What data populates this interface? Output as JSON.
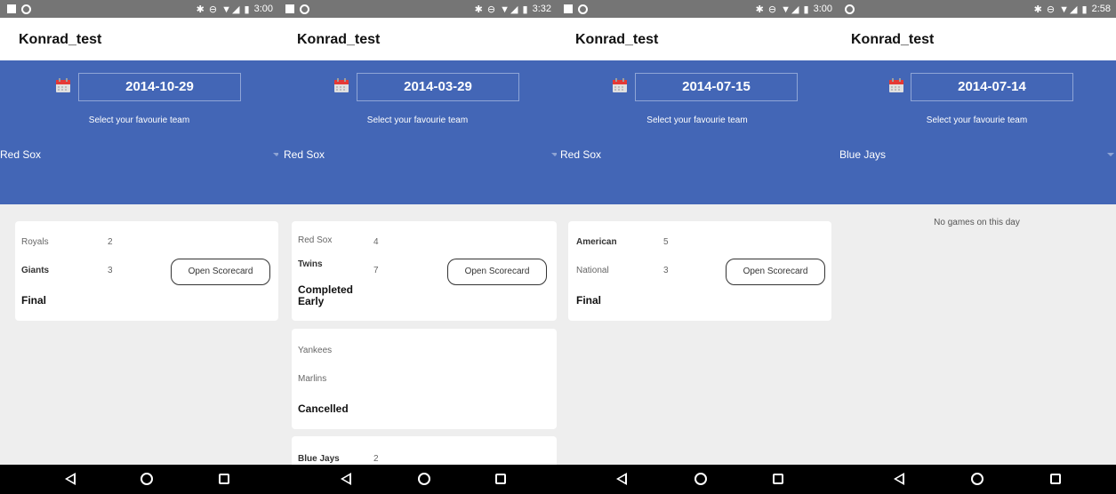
{
  "colors": {
    "status_bar": "#757575",
    "header_blue": "#4366b6",
    "background": "#eeeeee",
    "nav_bar": "#000000"
  },
  "screens": [
    {
      "status_time": "3:00",
      "title": "Konrad_test",
      "date": "2014-10-29",
      "select_label": "Select your favourie team",
      "team": "Red Sox",
      "games": [
        {
          "team1": "Royals",
          "score1": "2",
          "team2": "Giants",
          "score2": "3",
          "status": "Final",
          "button": "Open Scorecard"
        }
      ]
    },
    {
      "status_time": "3:32",
      "title": "Konrad_test",
      "date": "2014-03-29",
      "select_label": "Select your favourie team",
      "team": "Red Sox",
      "games": [
        {
          "team1": "Red Sox",
          "score1": "4",
          "team2": "Twins",
          "score2": "7",
          "status": "Completed Early",
          "button": "Open Scorecard"
        },
        {
          "team1": "Yankees",
          "team2": "Marlins",
          "status": "Cancelled"
        },
        {
          "team1": "Blue Jays",
          "score1": "2"
        }
      ]
    },
    {
      "status_time": "3:00",
      "title": "Konrad_test",
      "date": "2014-07-15",
      "select_label": "Select your favourie team",
      "team": "Red Sox",
      "games": [
        {
          "team1": "American",
          "score1": "5",
          "team2": "National",
          "score2": "3",
          "status": "Final",
          "button": "Open Scorecard"
        }
      ]
    },
    {
      "status_time": "2:58",
      "title": "Konrad_test",
      "date": "2014-07-14",
      "select_label": "Select your favourie team",
      "team": "Blue Jays",
      "empty_message": "No games on this day"
    }
  ]
}
